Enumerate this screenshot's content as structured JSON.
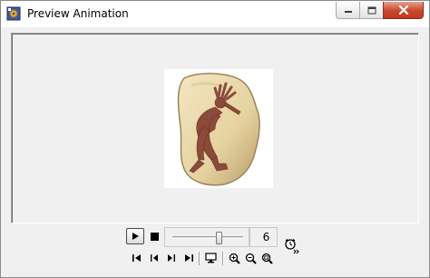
{
  "window": {
    "title": "Preview Animation",
    "caption_buttons": [
      "minimize-icon",
      "maximize-icon",
      "close-icon"
    ]
  },
  "preview": {
    "image": "kokopelli-stone-figure"
  },
  "playback": {
    "frame_value": "6",
    "slider_position": 0.66,
    "icons": [
      "play-icon",
      "stop-icon",
      "clock-icon"
    ]
  },
  "toolbar": {
    "icons": [
      "first-frame-icon",
      "previous-frame-icon",
      "next-frame-icon",
      "last-frame-icon",
      "monitor-icon",
      "zoom-in-icon",
      "zoom-out-icon",
      "zoom-fit-icon"
    ]
  },
  "colors": {
    "close_button": "#c9462c",
    "stone": "#e8d7a8",
    "figure": "#8c4a3a"
  }
}
